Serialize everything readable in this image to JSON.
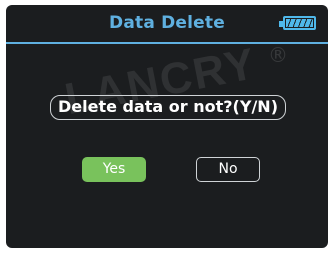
{
  "header": {
    "title": "Data Delete",
    "battery_icon": "battery-full-icon"
  },
  "watermark": {
    "text": "LANCRY",
    "registered_mark": "®"
  },
  "dialog": {
    "prompt": "Delete data or not?(Y/N)",
    "yes_label": "Yes",
    "no_label": "No"
  },
  "colors": {
    "title": "#5fb0e0",
    "battery": "#4fb8ea",
    "yes_button": "#79c25c",
    "background": "#1b1d1f"
  }
}
